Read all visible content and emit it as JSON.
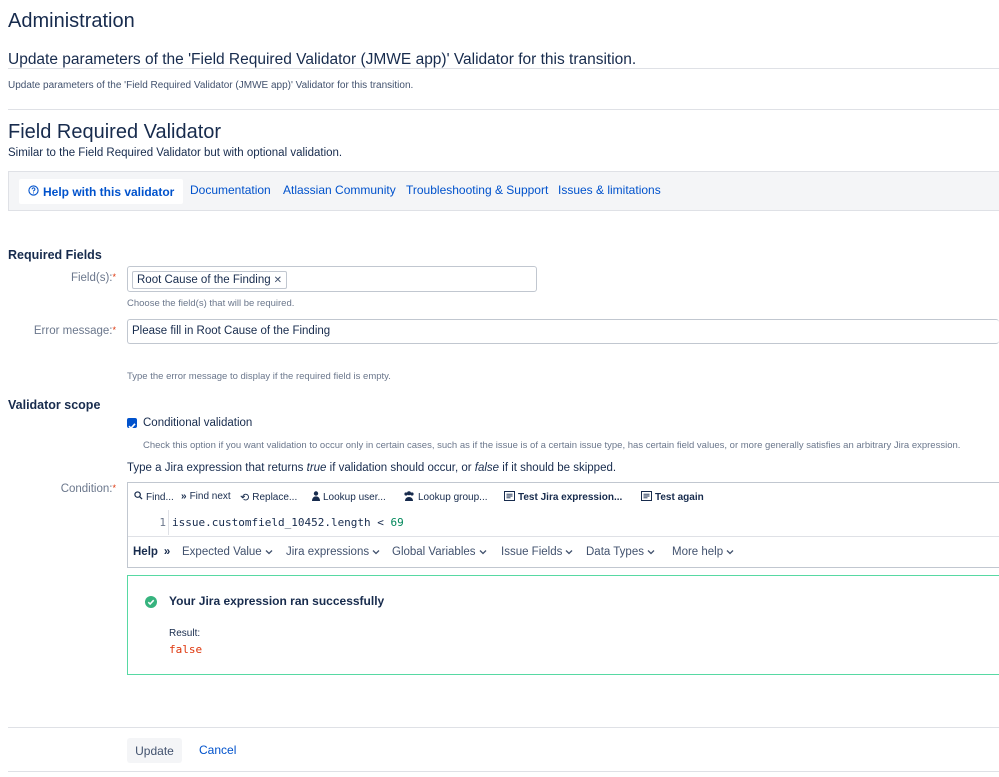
{
  "page": {
    "admin_title": "Administration",
    "subtitle": "Update parameters of the 'Field Required Validator (JMWE app)' Validator for this transition.",
    "description": "Update parameters of the 'Field Required Validator (JMWE app)' Validator for this transition."
  },
  "validator": {
    "title": "Field Required Validator",
    "subtitle": "Similar to the Field Required Validator but with optional validation."
  },
  "help_bar": {
    "active_tab": "Help with this validator",
    "links": [
      "Documentation",
      "Atlassian Community",
      "Troubleshooting & Support",
      "Issues & limitations"
    ]
  },
  "required_fields": {
    "section_title": "Required Fields",
    "fields_label": "Field(s):",
    "selected_field": "Root Cause of the Finding",
    "fields_hint": "Choose the field(s) that will be required.",
    "error_label": "Error message:",
    "error_value": "Please fill in Root Cause of the Finding",
    "error_hint": "Type the error message to display if the required field is empty."
  },
  "scope": {
    "section_title": "Validator scope",
    "conditional_label": "Conditional validation",
    "conditional_checked": true,
    "conditional_hint": "Check this option if you want validation to occur only in certain cases, such as if the issue is of a certain issue type, has certain field values, or more generally satisfies an arbitrary Jira expression.",
    "instr_prefix": "Type a Jira expression that returns ",
    "instr_true": "true",
    "instr_mid": " if validation should occur, or ",
    "instr_false": "false",
    "instr_suffix": " if it should be skipped.",
    "condition_label": "Condition:"
  },
  "editor": {
    "toolbar": {
      "find": "Find...",
      "find_next": "Find next",
      "replace": "Replace...",
      "lookup_user": "Lookup user...",
      "lookup_group": "Lookup group...",
      "test_expression": "Test Jira expression...",
      "test_again": "Test again"
    },
    "line_number": "1",
    "code_text": "issue.customfield_10452.length < ",
    "code_number": "69",
    "help": {
      "label": "Help",
      "items": [
        "Expected Value",
        "Jira expressions",
        "Global Variables",
        "Issue Fields",
        "Data Types",
        "More help"
      ]
    }
  },
  "result": {
    "message": "Your Jira expression ran successfully",
    "label": "Result:",
    "value": "false"
  },
  "buttons": {
    "update": "Update",
    "cancel": "Cancel"
  },
  "colors": {
    "link": "#0052cc",
    "required": "#de350b",
    "success": "#36b37e",
    "result_value": "#de350b"
  }
}
